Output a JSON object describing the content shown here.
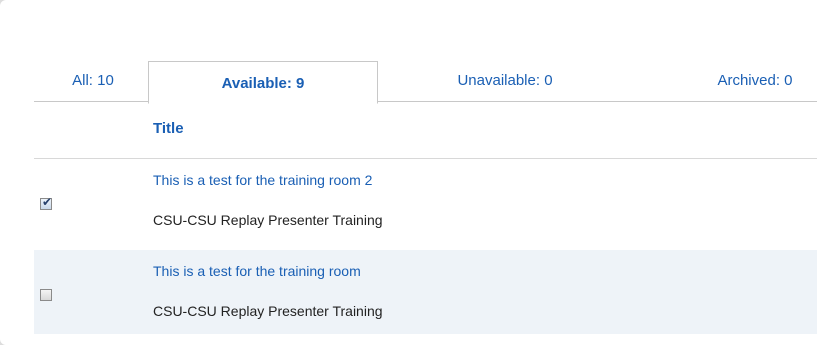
{
  "tabs": [
    {
      "label": "All: 10",
      "active": false
    },
    {
      "label": "Available: 9",
      "active": true
    },
    {
      "label": "Unavailable: 0",
      "active": false
    },
    {
      "label": "Archived: 0",
      "active": false
    }
  ],
  "table": {
    "header": {
      "title": "Title"
    },
    "rows": [
      {
        "checked": true,
        "title": "This is a test for the training room 2",
        "subtitle": "CSU-CSU Replay Presenter Training"
      },
      {
        "checked": false,
        "title": "This is a test for the training room",
        "subtitle": "CSU-CSU Replay Presenter Training"
      }
    ]
  },
  "colors": {
    "link": "#1a5fb4",
    "alt_row": "#eef3f8",
    "text": "#222222"
  }
}
